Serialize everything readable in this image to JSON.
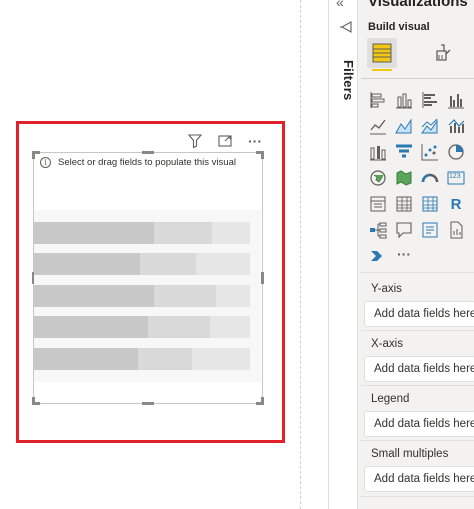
{
  "canvas": {
    "hint_text": "Select or drag fields to populate this visual",
    "info_icon": "i",
    "header_icons": [
      "filter-icon",
      "focus-mode-icon",
      "more-options-icon"
    ],
    "more_glyph": "···",
    "highlight_color": "#e0202b"
  },
  "filters_pane": {
    "label": "Filters",
    "collapse_glyph": "«"
  },
  "visualizations_pane": {
    "title": "Visualizations",
    "build_label": "Build visual",
    "more_glyph": "···",
    "tab_accent": "#f2c811",
    "r_label": "R",
    "kpi_label": "123",
    "wells": [
      {
        "label": "Y-axis",
        "placeholder": "Add data fields here"
      },
      {
        "label": "X-axis",
        "placeholder": "Add data fields here"
      },
      {
        "label": "Legend",
        "placeholder": "Add data fields here"
      },
      {
        "label": "Small multiples",
        "placeholder": "Add data fields here"
      }
    ]
  }
}
